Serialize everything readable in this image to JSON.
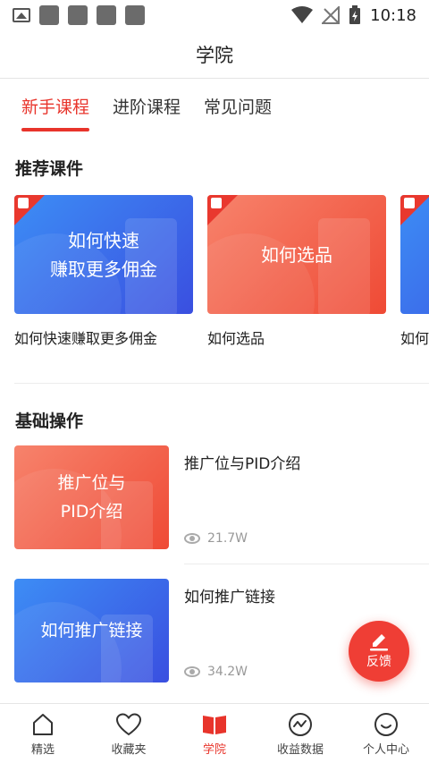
{
  "status_bar": {
    "time": "10:18"
  },
  "header": {
    "title": "学院"
  },
  "tabs": [
    {
      "label": "新手课程",
      "active": true
    },
    {
      "label": "进阶课程",
      "active": false
    },
    {
      "label": "常见问题",
      "active": false
    }
  ],
  "recommend": {
    "title": "推荐课件",
    "cards": [
      {
        "thumb_line1": "如何快速",
        "thumb_line2": "赚取更多佣金",
        "caption": "如何快速赚取更多佣金",
        "theme": "blue"
      },
      {
        "thumb_line1": "如何选品",
        "thumb_line2": "",
        "caption": "如何选品",
        "theme": "orange"
      },
      {
        "thumb_line1": "",
        "thumb_line2": "",
        "caption": "如何",
        "theme": "blue"
      }
    ]
  },
  "basic": {
    "title": "基础操作",
    "items": [
      {
        "thumb_line1": "推广位与",
        "thumb_line2": "PID介绍",
        "title": "推广位与PID介绍",
        "views": "21.7W",
        "theme": "orange"
      },
      {
        "thumb_line1": "如何推广链接",
        "thumb_line2": "",
        "title": "如何推广链接",
        "views": "34.2W",
        "theme": "blue"
      }
    ]
  },
  "fab": {
    "label": "反馈",
    "icon": "edit-icon"
  },
  "bottom_nav": [
    {
      "label": "精选",
      "icon": "home-icon",
      "active": false
    },
    {
      "label": "收藏夹",
      "icon": "heart-icon",
      "active": false
    },
    {
      "label": "学院",
      "icon": "book-icon",
      "active": true
    },
    {
      "label": "收益数据",
      "icon": "chart-icon",
      "active": false
    },
    {
      "label": "个人中心",
      "icon": "smile-icon",
      "active": false
    }
  ],
  "colors": {
    "accent": "#e8342b",
    "blue_start": "#3d8df5",
    "blue_end": "#3a4fe0",
    "orange_start": "#f7836c",
    "orange_end": "#ef4a35"
  }
}
